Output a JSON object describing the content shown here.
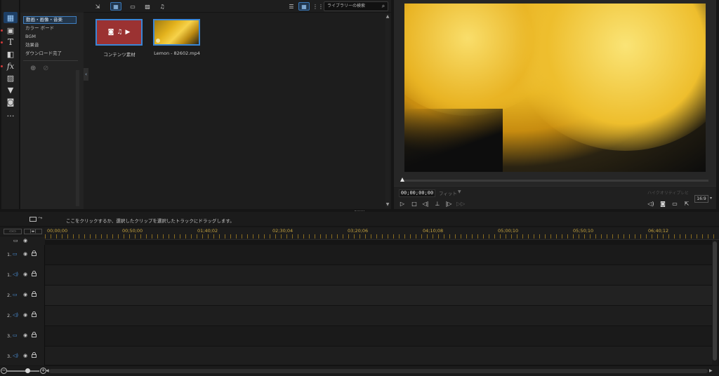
{
  "rail": {
    "items": [
      {
        "icon": "media-room-icon",
        "glyph": "▦"
      },
      {
        "icon": "color-board-icon",
        "glyph": "▣"
      },
      {
        "icon": "title-icon",
        "glyph": "T"
      },
      {
        "icon": "transition-icon",
        "glyph": "◧"
      },
      {
        "icon": "effects-icon",
        "glyph": "fx"
      },
      {
        "icon": "pip-icon",
        "glyph": "▨"
      },
      {
        "icon": "particle-icon",
        "glyph": "▼"
      },
      {
        "icon": "overlay-icon",
        "glyph": "◙"
      },
      {
        "icon": "more-icon",
        "glyph": "…"
      }
    ]
  },
  "categories": {
    "items": [
      {
        "label": "動画・画像・音楽",
        "selected": true
      },
      {
        "label": "カラー ボード",
        "selected": false
      },
      {
        "label": "BGM",
        "selected": false
      },
      {
        "label": "効果音",
        "selected": false
      },
      {
        "label": "ダウンロード完了",
        "selected": false
      }
    ]
  },
  "library": {
    "search_placeholder": "ライブラリーの検索",
    "items": [
      {
        "caption": "コンテンツ素材"
      },
      {
        "caption": "Lemon - 82602.mp4"
      }
    ]
  },
  "preview": {
    "timecode": "00;00;00;00",
    "fit_label": "フィット",
    "hq_label": "ハイクオリティプレビュー",
    "aspect_ratio": "16:9"
  },
  "timeline": {
    "hint": "ここをクリックするか、選択したクリップを選択したトラックにドラッグします。",
    "ruler_labels": [
      "00;00;00",
      "00;50;00",
      "01;40;02",
      "02;30;04",
      "03;20;06",
      "04;10;08",
      "05;00;10",
      "05;50;10",
      "06;40;12"
    ],
    "tracks": [
      {
        "number": "1.",
        "type": "video",
        "glyph": "▭"
      },
      {
        "number": "1.",
        "type": "audio",
        "glyph": "◁)"
      },
      {
        "number": "2.",
        "type": "video",
        "glyph": "▭"
      },
      {
        "number": "2.",
        "type": "audio",
        "glyph": "◁)"
      },
      {
        "number": "3.",
        "type": "video",
        "glyph": "▭"
      },
      {
        "number": "3.",
        "type": "audio",
        "glyph": "◁)"
      }
    ]
  },
  "colors": {
    "accent": "#3a86d6",
    "ruler_text": "#c9a640",
    "content_tile": "#9b3232"
  }
}
